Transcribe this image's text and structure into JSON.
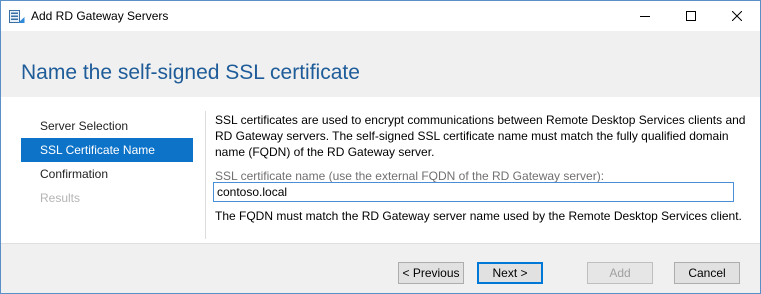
{
  "window": {
    "title": "Add RD Gateway Servers",
    "controls": [
      "minimize-icon",
      "maximize-icon",
      "close-icon"
    ]
  },
  "page": {
    "title": "Name the self-signed SSL certificate",
    "title_color": "#1e5c99"
  },
  "nav": {
    "items": [
      {
        "label": "Server Selection",
        "state": "normal"
      },
      {
        "label": "SSL Certificate Name",
        "state": "selected"
      },
      {
        "label": "Confirmation",
        "state": "normal"
      },
      {
        "label": "Results",
        "state": "disabled"
      }
    ],
    "selected_color": "#0d73c8"
  },
  "content": {
    "description": "SSL certificates are used to encrypt communications between Remote Desktop Services clients and RD Gateway servers. The self-signed SSL certificate name must match the fully qualified domain name (FQDN) of the RD Gateway server.",
    "field_label": "SSL certificate name (use the external FQDN of the RD Gateway server):",
    "field_value": "contoso.local",
    "hint": "The FQDN must match the RD Gateway server name used by the Remote Desktop Services client."
  },
  "buttons": {
    "previous": "< Previous",
    "next": "Next >",
    "add": "Add",
    "cancel": "Cancel"
  }
}
